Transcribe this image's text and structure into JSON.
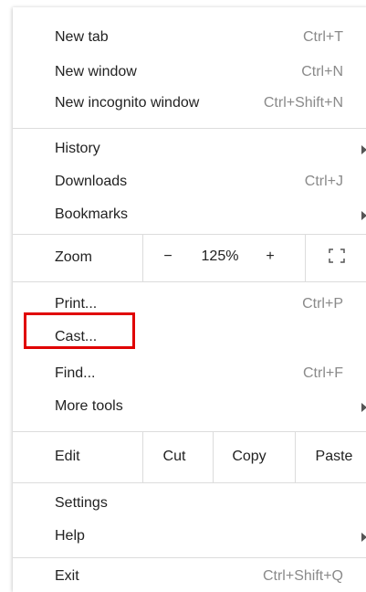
{
  "menu": {
    "group1": [
      {
        "label": "New tab",
        "shortcut": "Ctrl+T"
      },
      {
        "label": "New window",
        "shortcut": "Ctrl+N"
      },
      {
        "label": "New incognito window",
        "shortcut": "Ctrl+Shift+N"
      }
    ],
    "group2": [
      {
        "label": "History",
        "shortcut": ""
      },
      {
        "label": "Downloads",
        "shortcut": "Ctrl+J"
      },
      {
        "label": "Bookmarks",
        "shortcut": ""
      }
    ],
    "zoom": {
      "label": "Zoom",
      "minus": "−",
      "value": "125%",
      "plus": "+"
    },
    "group3": [
      {
        "label": "Print...",
        "shortcut": "Ctrl+P"
      },
      {
        "label": "Cast...",
        "shortcut": ""
      },
      {
        "label": "Find...",
        "shortcut": "Ctrl+F"
      },
      {
        "label": "More tools",
        "shortcut": ""
      }
    ],
    "edit": {
      "label": "Edit",
      "cut": "Cut",
      "copy": "Copy",
      "paste": "Paste"
    },
    "group4": [
      {
        "label": "Settings",
        "shortcut": ""
      },
      {
        "label": "Help",
        "shortcut": ""
      }
    ],
    "exit": {
      "label": "Exit",
      "shortcut": "Ctrl+Shift+Q"
    }
  },
  "icons": {
    "submenu": "submenu-arrow-icon",
    "fullscreen": "fullscreen-icon"
  },
  "colors": {
    "highlight": "#e00000",
    "shortcut_text": "#8a8a8a",
    "separator": "#dcdcdc"
  }
}
